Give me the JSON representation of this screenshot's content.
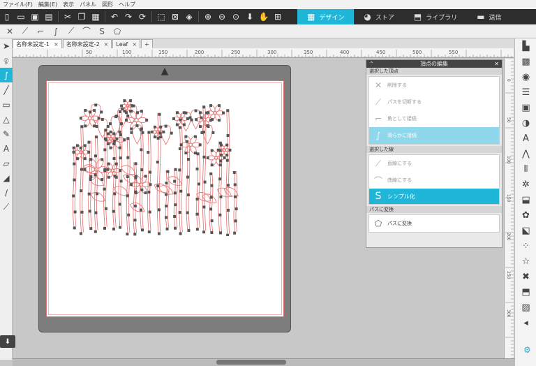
{
  "menu": [
    "ファイル(F)",
    "編集(E)",
    "表示",
    "パネル",
    "図形",
    "ヘルプ"
  ],
  "main_tabs": [
    {
      "label": "デザイン",
      "icon": "grid-icon"
    },
    {
      "label": "ストア",
      "icon": "store-icon"
    },
    {
      "label": "ライブラリ",
      "icon": "library-icon"
    },
    {
      "label": "送信",
      "icon": "send-icon"
    }
  ],
  "doc_tabs": [
    "名称未設定-1",
    "名称未設定-2",
    "Leaf",
    "+"
  ],
  "ruler_top_labels": [
    "50",
    "100",
    "150",
    "200",
    "250",
    "300",
    "350",
    "400",
    "450",
    "500",
    "550"
  ],
  "ruler_right_labels": [
    "0",
    "50",
    "100",
    "150",
    "200",
    "250",
    "300"
  ],
  "vertex_panel": {
    "title": "頂点の編集",
    "sections": [
      {
        "label": "選択した頂点",
        "rows": [
          "削除する",
          "パスを切断する",
          "角として接続",
          "滑らかに接続"
        ]
      },
      {
        "label": "選択した線",
        "rows": [
          "直線にする",
          "曲線にする"
        ]
      },
      {
        "label": "",
        "rows": [
          "シンプル化"
        ]
      },
      {
        "label": "パスに変換",
        "rows": [
          "パスに変換"
        ]
      }
    ]
  },
  "colors": {
    "accent": "#1fb6d8",
    "cut_line": "#e46c6c"
  }
}
